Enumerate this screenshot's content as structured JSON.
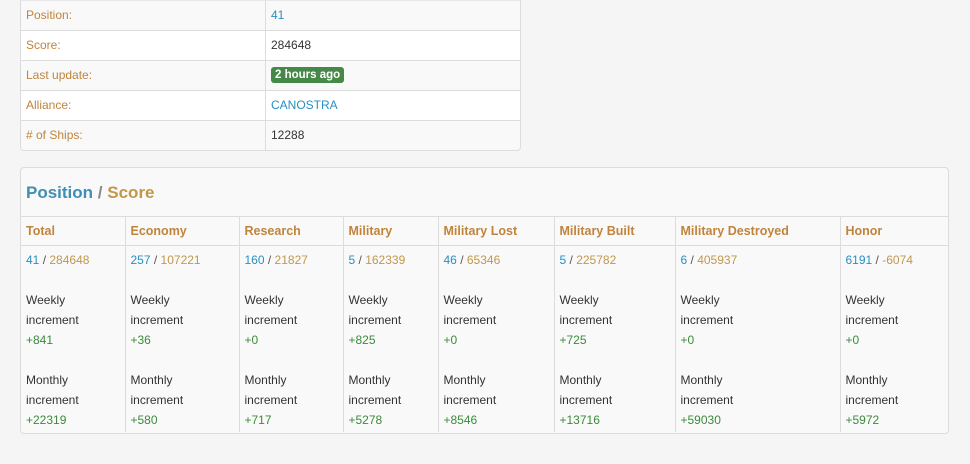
{
  "info": {
    "rows": [
      {
        "label": "Position:",
        "value": "41"
      },
      {
        "label": "Score:",
        "value": "284648"
      },
      {
        "label": "Last update:",
        "value": "2 hours ago"
      },
      {
        "label": "Alliance:",
        "value": "CANOSTRA"
      },
      {
        "label": "# of Ships:",
        "value": "12288"
      }
    ]
  },
  "panel": {
    "title_position": "Position",
    "title_sep": "/",
    "title_score": "Score",
    "weekly_label_1": "Weekly",
    "weekly_label_2": "increment",
    "monthly_label_1": "Monthly",
    "monthly_label_2": "increment",
    "columns": [
      {
        "name": "Total",
        "pos": "41",
        "score": "284648",
        "weekly": "+841",
        "monthly": "+22319"
      },
      {
        "name": "Economy",
        "pos": "257",
        "score": "107221",
        "weekly": "+36",
        "monthly": "+580"
      },
      {
        "name": "Research",
        "pos": "160",
        "score": "21827",
        "weekly": "+0",
        "monthly": "+717"
      },
      {
        "name": "Military",
        "pos": "5",
        "score": "162339",
        "weekly": "+825",
        "monthly": "+5278"
      },
      {
        "name": "Military Lost",
        "pos": "46",
        "score": "65346",
        "weekly": "+0",
        "monthly": "+8546"
      },
      {
        "name": "Military Built",
        "pos": "5",
        "score": "225782",
        "weekly": "+725",
        "monthly": "+13716"
      },
      {
        "name": "Military Destroyed",
        "pos": "6",
        "score": "405937",
        "weekly": "+0",
        "monthly": "+59030"
      },
      {
        "name": "Honor",
        "pos": "6191",
        "score": "-6074",
        "weekly": "+0",
        "monthly": "+5972"
      }
    ]
  },
  "colors": {
    "label": "#c0843c",
    "link": "#2a8fc1",
    "score": "#c0984c",
    "increment": "#3c8a3c",
    "badge": "#468847"
  }
}
